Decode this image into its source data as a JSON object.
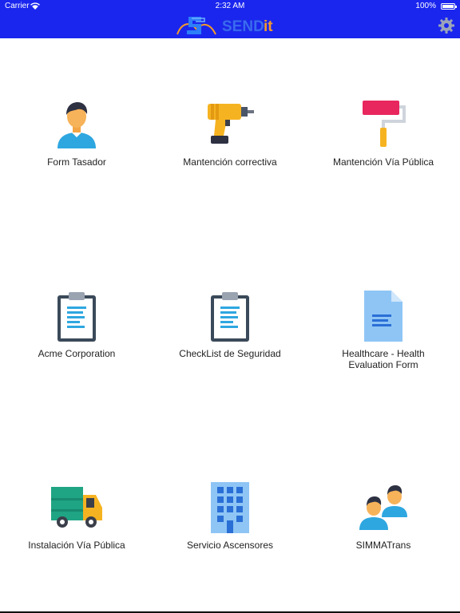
{
  "status_bar": {
    "carrier": "Carrier",
    "time": "2:32 AM",
    "battery": "100%"
  },
  "header": {
    "logo_text": "SENDit",
    "settings_icon": "gear-icon"
  },
  "colors": {
    "bar": "#1a26ee",
    "logo_orange": "#f39a2b",
    "logo_blue": "#2d7ff9"
  },
  "tiles": [
    {
      "label": "Form Tasador",
      "icon": "person-icon"
    },
    {
      "label": "Mantención correctiva",
      "icon": "drill-icon"
    },
    {
      "label": "Mantención Vía Pública",
      "icon": "paint-roller-icon"
    },
    {
      "label": "Acme Corporation",
      "icon": "clipboard-icon"
    },
    {
      "label": "CheckList de Seguridad",
      "icon": "clipboard-icon"
    },
    {
      "label": "Healthcare - Health Evaluation Form",
      "icon": "document-icon"
    },
    {
      "label": "Instalación Vía Pública",
      "icon": "truck-icon"
    },
    {
      "label": "Servicio Ascensores",
      "icon": "building-icon"
    },
    {
      "label": "SIMMATrans",
      "icon": "people-icon"
    }
  ]
}
